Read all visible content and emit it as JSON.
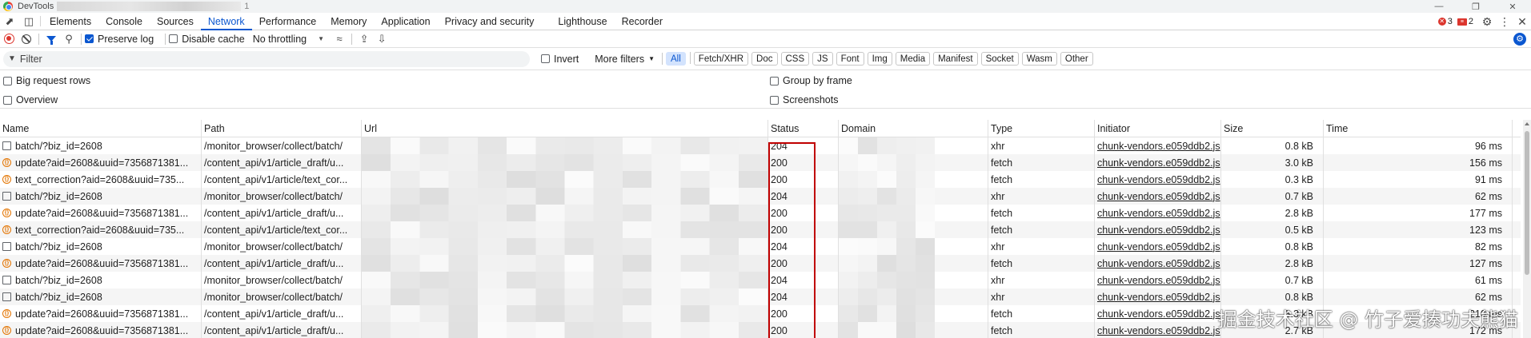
{
  "window": {
    "title": "DevTools",
    "title_suffix": "1"
  },
  "tabs": [
    {
      "label": "Elements"
    },
    {
      "label": "Console"
    },
    {
      "label": "Sources"
    },
    {
      "label": "Network"
    },
    {
      "label": "Performance"
    },
    {
      "label": "Memory"
    },
    {
      "label": "Application"
    },
    {
      "label": "Privacy and security"
    },
    {
      "label": "Lighthouse"
    },
    {
      "label": "Recorder"
    }
  ],
  "active_tab": "Network",
  "badges": {
    "errors": "3",
    "warnings": "2"
  },
  "toolbar": {
    "preserve_log": "Preserve log",
    "disable_cache": "Disable cache",
    "throttling": "No throttling"
  },
  "filter": {
    "placeholder": "Filter",
    "invert": "Invert",
    "more_filters": "More filters",
    "types": [
      "All",
      "Fetch/XHR",
      "Doc",
      "CSS",
      "JS",
      "Font",
      "Img",
      "Media",
      "Manifest",
      "Socket",
      "Wasm",
      "Other"
    ]
  },
  "options": {
    "big_request_rows": "Big request rows",
    "overview": "Overview",
    "group_by_frame": "Group by frame",
    "screenshots": "Screenshots"
  },
  "columns": [
    "Name",
    "Path",
    "Url",
    "Status",
    "Domain",
    "Type",
    "Initiator",
    "Size",
    "Time"
  ],
  "rows": [
    {
      "icon": "doc",
      "name": "batch/?biz_id=2608",
      "path": "/monitor_browser/collect/batch/",
      "status": "204",
      "type": "xhr",
      "initiator": "chunk-vendors.e059ddb2.js",
      "size": "0.8 kB",
      "time": "96 ms"
    },
    {
      "icon": "fetch",
      "name": "update?aid=2608&uuid=7356871381...",
      "path": "/content_api/v1/article_draft/u...",
      "status": "200",
      "type": "fetch",
      "initiator": "chunk-vendors.e059ddb2.js",
      "size": "3.0 kB",
      "time": "156 ms"
    },
    {
      "icon": "fetch",
      "name": "text_correction?aid=2608&uuid=735...",
      "path": "/content_api/v1/article/text_cor...",
      "status": "200",
      "type": "fetch",
      "initiator": "chunk-vendors.e059ddb2.js",
      "size": "0.3 kB",
      "time": "91 ms"
    },
    {
      "icon": "doc",
      "name": "batch/?biz_id=2608",
      "path": "/monitor_browser/collect/batch/",
      "status": "204",
      "type": "xhr",
      "initiator": "chunk-vendors.e059ddb2.js",
      "size": "0.7 kB",
      "time": "62 ms"
    },
    {
      "icon": "fetch",
      "name": "update?aid=2608&uuid=7356871381...",
      "path": "/content_api/v1/article_draft/u...",
      "status": "200",
      "type": "fetch",
      "initiator": "chunk-vendors.e059ddb2.js",
      "size": "2.8 kB",
      "time": "177 ms"
    },
    {
      "icon": "fetch",
      "name": "text_correction?aid=2608&uuid=735...",
      "path": "/content_api/v1/article/text_cor...",
      "status": "200",
      "type": "fetch",
      "initiator": "chunk-vendors.e059ddb2.js",
      "size": "0.5 kB",
      "time": "123 ms"
    },
    {
      "icon": "doc",
      "name": "batch/?biz_id=2608",
      "path": "/monitor_browser/collect/batch/",
      "status": "204",
      "type": "xhr",
      "initiator": "chunk-vendors.e059ddb2.js",
      "size": "0.8 kB",
      "time": "82 ms"
    },
    {
      "icon": "fetch",
      "name": "update?aid=2608&uuid=7356871381...",
      "path": "/content_api/v1/article_draft/u...",
      "status": "200",
      "type": "fetch",
      "initiator": "chunk-vendors.e059ddb2.js",
      "size": "2.8 kB",
      "time": "127 ms"
    },
    {
      "icon": "doc",
      "name": "batch/?biz_id=2608",
      "path": "/monitor_browser/collect/batch/",
      "status": "204",
      "type": "xhr",
      "initiator": "chunk-vendors.e059ddb2.js",
      "size": "0.7 kB",
      "time": "61 ms"
    },
    {
      "icon": "doc",
      "name": "batch/?biz_id=2608",
      "path": "/monitor_browser/collect/batch/",
      "status": "204",
      "type": "xhr",
      "initiator": "chunk-vendors.e059ddb2.js",
      "size": "0.8 kB",
      "time": "62 ms"
    },
    {
      "icon": "fetch",
      "name": "update?aid=2608&uuid=7356871381...",
      "path": "/content_api/v1/article_draft/u...",
      "status": "200",
      "type": "fetch",
      "initiator": "chunk-vendors.e059ddb2.js",
      "size": "3.3 kB",
      "time": "210 ms"
    },
    {
      "icon": "fetch",
      "name": "update?aid=2608&uuid=7356871381...",
      "path": "/content_api/v1/article_draft/u...",
      "status": "200",
      "type": "fetch",
      "initiator": "chunk-vendors.e059ddb2.js",
      "size": "2.7 kB",
      "time": "172 ms"
    }
  ],
  "watermark": "掘金技术社区 @ 竹子爱揍功夫熊猫",
  "colors": {
    "accent": "#0b57d0",
    "error": "#dc362e",
    "highlight_box": "#c00000"
  }
}
